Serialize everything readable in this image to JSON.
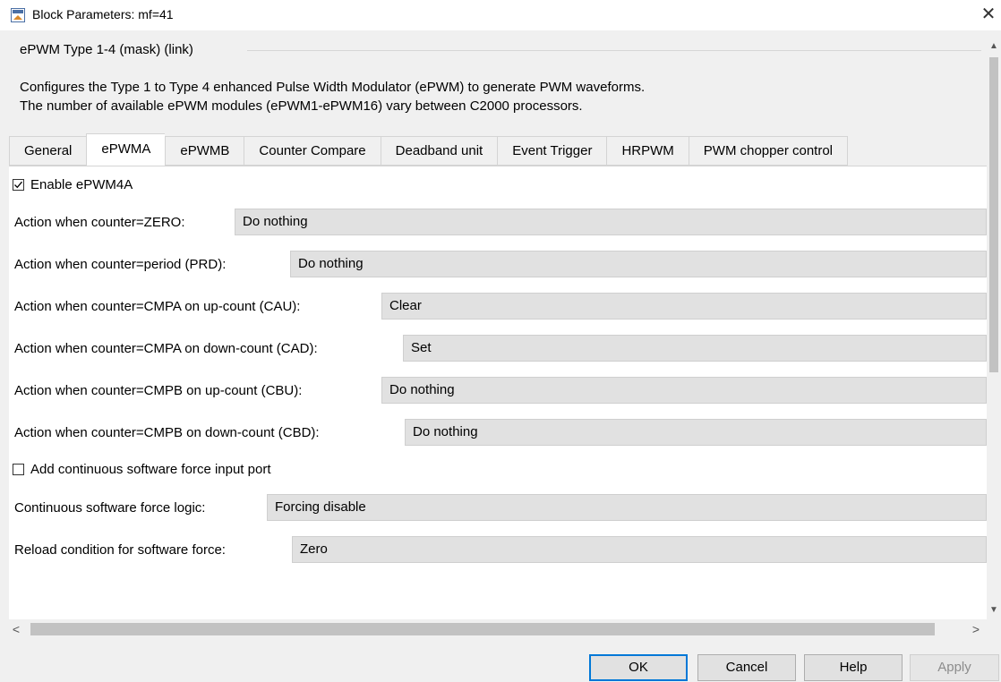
{
  "window": {
    "title": "Block Parameters: mf=41",
    "app_icon": "simulink-block-icon",
    "close_icon": "close-icon"
  },
  "group": {
    "legend": "ePWM Type 1-4 (mask) (link)",
    "description_line1": "Configures the Type 1 to Type 4 enhanced Pulse Width Modulator (ePWM) to generate PWM waveforms.",
    "description_line2": "The number of available ePWM modules (ePWM1-ePWM16) vary between C2000 processors."
  },
  "tabs": [
    {
      "label": "General",
      "active": false
    },
    {
      "label": "ePWMA",
      "active": true
    },
    {
      "label": "ePWMB",
      "active": false
    },
    {
      "label": "Counter Compare",
      "active": false
    },
    {
      "label": "Deadband unit",
      "active": false
    },
    {
      "label": "Event Trigger",
      "active": false
    },
    {
      "label": "HRPWM",
      "active": false
    },
    {
      "label": "PWM chopper control",
      "active": false
    }
  ],
  "form": {
    "enable_checkbox": {
      "label": "Enable ePWM4A",
      "checked": true
    },
    "zero": {
      "label": "Action when counter=ZERO:",
      "value": "Do nothing"
    },
    "prd": {
      "label": "Action when counter=period (PRD):",
      "value": "Do nothing"
    },
    "cau": {
      "label": "Action when counter=CMPA on up-count (CAU):",
      "value": "Clear"
    },
    "cad": {
      "label": "Action when counter=CMPA on down-count (CAD):",
      "value": "Set"
    },
    "cbu": {
      "label": "Action when counter=CMPB on up-count (CBU):",
      "value": "Do nothing"
    },
    "cbd": {
      "label": "Action when counter=CMPB on down-count (CBD):",
      "value": "Do nothing"
    },
    "force_checkbox": {
      "label": "Add continuous software force input port",
      "checked": false
    },
    "force_logic": {
      "label": "Continuous software force logic:",
      "value": "Forcing disable"
    },
    "reload": {
      "label": "Reload condition for software force:",
      "value": "Zero"
    }
  },
  "scroll": {
    "left_arrow": "<",
    "right_arrow": ">"
  },
  "buttons": {
    "ok": "OK",
    "cancel": "Cancel",
    "help": "Help",
    "apply": "Apply"
  }
}
